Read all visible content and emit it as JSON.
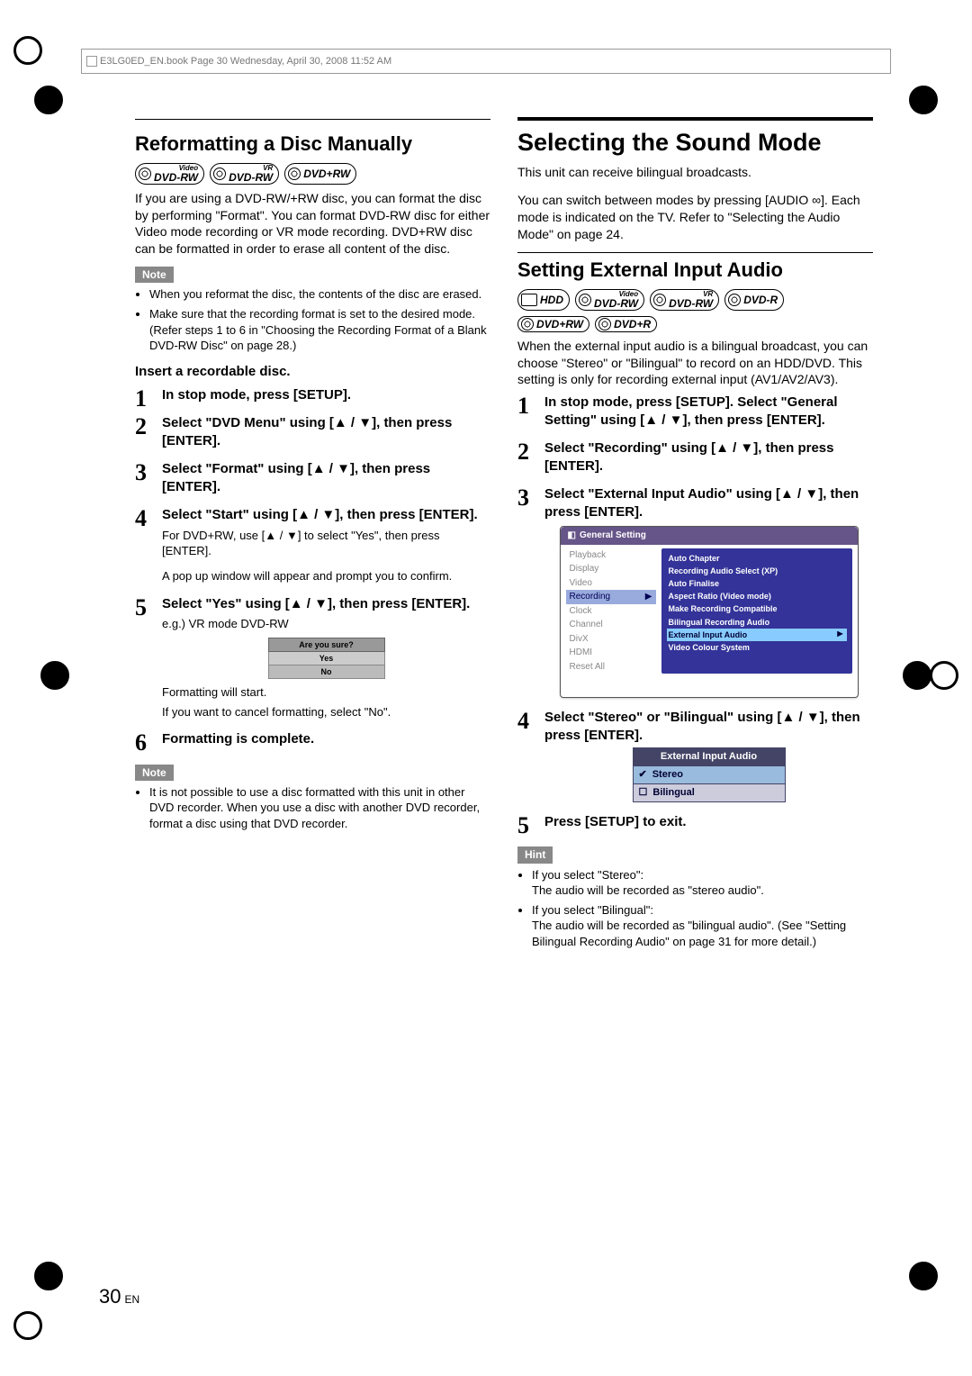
{
  "header_line": "E3LG0ED_EN.book  Page 30  Wednesday, April 30, 2008  11:52 AM",
  "page_number": "30",
  "page_lang": "EN",
  "left": {
    "hr1_above": "Reformatting a Disc Manually",
    "discs": [
      {
        "main": "DVD-RW",
        "sup": "Video"
      },
      {
        "main": "DVD-RW",
        "sup": "VR"
      },
      {
        "main": "DVD+RW",
        "sup": ""
      }
    ],
    "intro": "If you are using a DVD-RW/+RW disc, you can format the disc by performing \"Format\". You can format DVD-RW disc for either Video mode recording or VR mode recording. DVD+RW disc can be formatted in order to erase all content of the disc.",
    "note_label": "Note",
    "notes": [
      "When you reformat the disc, the contents of the disc are erased.",
      "Make sure that the recording format is set to the desired mode. (Refer steps 1 to 6 in \"Choosing the Recording Format of a Blank DVD-RW Disc\" on page 28.)"
    ],
    "insert_bold": "Insert a recordable disc.",
    "steps": [
      {
        "head": "In stop mode, press [SETUP]."
      },
      {
        "head": "Select \"DVD Menu\" using [▲ / ▼], then press [ENTER]."
      },
      {
        "head": "Select \"Format\" using [▲ / ▼], then press [ENTER]."
      },
      {
        "head": "Select \"Start\" using [▲ / ▼], then press [ENTER].",
        "sub": "For DVD+RW, use [▲ / ▼] to select \"Yes\", then press [ENTER].",
        "sub2": "A pop up window will appear and prompt you to confirm."
      },
      {
        "head": "Select \"Yes\" using [▲ / ▼], then press [ENTER].",
        "eg": "e.g.) VR mode DVD-RW",
        "dialog": {
          "title": "Are you sure?",
          "opt1": "Yes",
          "opt2": "No"
        },
        "after1": "Formatting will start.",
        "after2": "If you want to cancel formatting, select \"No\"."
      },
      {
        "head": "Formatting is complete."
      }
    ],
    "note2_label": "Note",
    "notes2": [
      "It is not possible to use a disc formatted with this unit in other DVD recorder. When you use a disc with another DVD recorder, format a disc using that DVD recorder."
    ]
  },
  "right": {
    "h1": "Selecting the Sound Mode",
    "intro1": "This unit can receive bilingual broadcasts.",
    "intro2": "You can switch between modes by pressing [AUDIO ∞]. Each mode is indicated on the TV. Refer to \"Selecting the Audio Mode\" on page 24.",
    "h2": "Setting External Input Audio",
    "discs_row1": [
      {
        "main": "HDD",
        "sup": "",
        "hdd": true
      },
      {
        "main": "DVD-RW",
        "sup": "Video"
      },
      {
        "main": "DVD-RW",
        "sup": "VR"
      },
      {
        "main": "DVD-R",
        "sup": ""
      }
    ],
    "discs_row2": [
      {
        "main": "DVD+RW",
        "sup": ""
      },
      {
        "main": "DVD+R",
        "sup": ""
      }
    ],
    "intro3": "When the external input audio is a bilingual broadcast, you can choose \"Stereo\" or \"Bilingual\" to record on an HDD/DVD. This setting is only for recording external input (AV1/AV2/AV3).",
    "steps": [
      {
        "head": "In stop mode, press [SETUP]. Select \"General Setting\" using [▲ / ▼], then press [ENTER]."
      },
      {
        "head": "Select \"Recording\" using [▲ / ▼], then press [ENTER]."
      },
      {
        "head": "Select \"External Input Audio\" using [▲ / ▼], then press [ENTER].",
        "menu": {
          "title": "General Setting",
          "left": [
            "Playback",
            "Display",
            "Video",
            "Recording",
            "Clock",
            "Channel",
            "DivX",
            "HDMI",
            "Reset All"
          ],
          "left_active": 3,
          "right": [
            "Auto Chapter",
            "Recording Audio Select (XP)",
            "Auto Finalise",
            "Aspect Ratio (Video mode)",
            "Make Recording Compatible",
            "Bilingual Recording Audio",
            "External Input Audio",
            "Video Colour System"
          ],
          "right_active": 6
        }
      },
      {
        "head": "Select \"Stereo\" or \"Bilingual\" using [▲ / ▼], then press [ENTER].",
        "radio": {
          "title": "External Input Audio",
          "opts": [
            "Stereo",
            "Bilingual"
          ],
          "selected": 0
        }
      },
      {
        "head": "Press [SETUP] to exit."
      }
    ],
    "hint_label": "Hint",
    "hints": [
      "If you select \"Stereo\":\nThe audio will be recorded as \"stereo audio\".",
      "If you select \"Bilingual\":\nThe audio will be recorded as \"bilingual audio\". (See \"Setting Bilingual Recording Audio\" on page 31 for more detail.)"
    ]
  }
}
